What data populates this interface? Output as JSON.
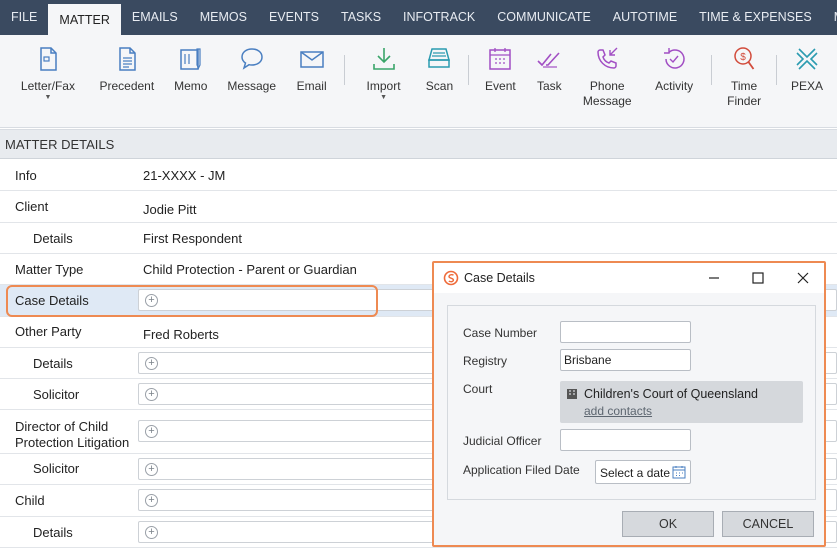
{
  "menu": {
    "tabs": [
      "FILE",
      "MATTER",
      "EMAILS",
      "MEMOS",
      "EVENTS",
      "TASKS",
      "INFOTRACK",
      "COMMUNICATE",
      "AUTOTIME",
      "TIME & EXPENSES",
      "MA"
    ],
    "active_index": 1
  },
  "ribbon": {
    "letter_fax": "Letter/Fax",
    "precedent": "Precedent",
    "memo": "Memo",
    "message": "Message",
    "email": "Email",
    "import": "Import",
    "scan": "Scan",
    "event": "Event",
    "task": "Task",
    "phone_message_1": "Phone",
    "phone_message_2": "Message",
    "activity": "Activity",
    "time_finder_1": "Time",
    "time_finder_2": "Finder",
    "pexa": "PEXA"
  },
  "section": {
    "title": "MATTER DETAILS"
  },
  "rows": {
    "info": {
      "label": "Info",
      "value": "21-XXXX - JM"
    },
    "client": {
      "label": "Client",
      "value": "Jodie Pitt"
    },
    "client_details": {
      "label": "Details",
      "value": "First Respondent"
    },
    "matter_type": {
      "label": "Matter Type",
      "value": "Child Protection - Parent or Guardian"
    },
    "case_details": {
      "label": "Case Details"
    },
    "other_party": {
      "label": "Other Party",
      "value": "Fred Roberts"
    },
    "other_party_details": {
      "label": "Details"
    },
    "other_party_solicitor": {
      "label": "Solicitor"
    },
    "director_1": "Director of Child",
    "director_2": "Protection Litigation",
    "director_solicitor": {
      "label": "Solicitor"
    },
    "child": {
      "label": "Child"
    },
    "child_details": {
      "label": "Details"
    }
  },
  "dialog": {
    "title": "Case Details",
    "case_number_label": "Case Number",
    "case_number_value": "",
    "registry_label": "Registry",
    "registry_value": "Brisbane",
    "court_label": "Court",
    "court_value": "Children's Court of Queensland",
    "court_link": "add contacts",
    "judicial_officer_label": "Judicial Officer",
    "judicial_officer_value": "",
    "filed_date_label": "Application Filed Date",
    "filed_date_placeholder": "Select a date",
    "ok": "OK",
    "cancel": "CANCEL"
  },
  "colors": {
    "menubar": "#3a4a60",
    "ribbon_icon": "#4a7fc1",
    "highlight": "#ee8a52",
    "purple_icon": "#a24fc4",
    "green_icon": "#3aa56a",
    "red_icon": "#d24b3b",
    "teal_icon": "#2a9bb0"
  }
}
